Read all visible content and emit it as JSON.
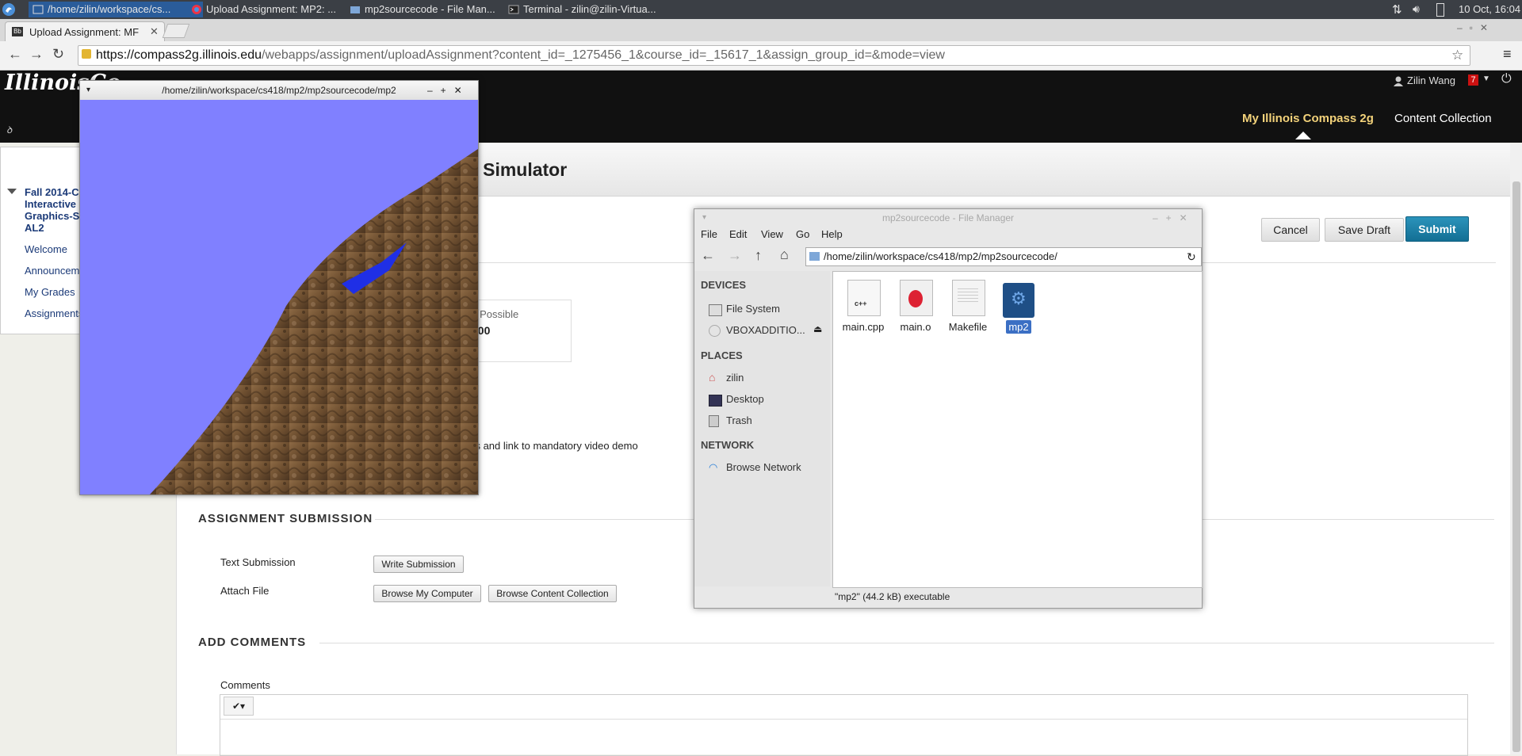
{
  "taskbar": {
    "tasks": [
      "/home/zilin/workspace/cs...",
      "Upload Assignment: MP2: ...",
      "mp2sourcecode - File Man...",
      "Terminal - zilin@zilin-Virtua..."
    ],
    "clock": "10 Oct, 16:04"
  },
  "browser": {
    "tab_title": "Upload Assignment: MF",
    "url_host": "https://compass2g.illinois.edu",
    "url_path": "/webapps/assignment/uploadAssignment?content_id=_1275456_1&course_id=_15617_1&assign_group_id=&mode=view"
  },
  "bb": {
    "logo": "IllinoisCo",
    "user_name": "Zilin Wang",
    "notification_count": "7",
    "nav_my": "My Illinois Compass 2g",
    "nav_content": "Content Collection"
  },
  "course_menu": {
    "course_title_lines": [
      "Fall 2014-C",
      "Interactive C",
      "Graphics-Se",
      "AL2"
    ],
    "items": [
      "Welcome",
      "Announcem",
      "My Grades",
      "Assignments"
    ]
  },
  "page": {
    "title_fragment": "nt Simulator",
    "cancel": "Cancel",
    "save_draft": "Save Draft",
    "submit": "Submit",
    "points_label": "s Possible",
    "points_value": "100",
    "instructions_fragment": "ons and link to mandatory video demo",
    "assignment_submission": "ASSIGNMENT SUBMISSION",
    "text_submission_label": "Text Submission",
    "write_submission": "Write Submission",
    "attach_file_label": "Attach File",
    "browse_computer": "Browse My Computer",
    "browse_content": "Browse Content Collection",
    "add_comments": "ADD COMMENTS",
    "comments_label": "Comments"
  },
  "gl_window": {
    "title": "/home/zilin/workspace/cs418/mp2/mp2sourcecode/mp2"
  },
  "file_manager": {
    "title": "mp2sourcecode - File Manager",
    "menu": [
      "File",
      "Edit",
      "View",
      "Go",
      "Help"
    ],
    "location": "/home/zilin/workspace/cs418/mp2/mp2sourcecode/",
    "devices_header": "DEVICES",
    "devices": [
      "File System",
      "VBOXADDITIO..."
    ],
    "places_header": "PLACES",
    "places": [
      "zilin",
      "Desktop",
      "Trash"
    ],
    "network_header": "NETWORK",
    "network": [
      "Browse Network"
    ],
    "files": [
      "main.cpp",
      "main.o",
      "Makefile",
      "mp2"
    ],
    "status": "\"mp2\" (44.2 kB) executable"
  },
  "colors": {
    "sky": "#8080ff",
    "accent_submit": "#1a7fa6",
    "selection": "#3b6fc4"
  }
}
